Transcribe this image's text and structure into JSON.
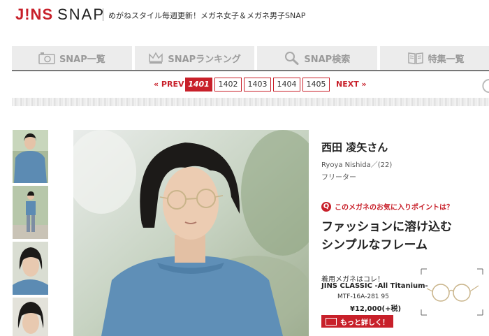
{
  "header": {
    "logo_brand": "J!NS",
    "logo_product": "SNAP",
    "tagline": "めがねスタイル毎週更新！メガネ女子＆メガネ男子SNAP"
  },
  "nav": {
    "items": [
      {
        "label": "SNAP一覧",
        "icon": "camera-icon"
      },
      {
        "label": "SNAPランキング",
        "icon": "crown-icon"
      },
      {
        "label": "SNAP検索",
        "icon": "magnifier-icon"
      },
      {
        "label": "特集一覧",
        "icon": "book-icon"
      }
    ]
  },
  "pager": {
    "prev": "« PREV",
    "next": "NEXT »",
    "pages": [
      "1401",
      "1402",
      "1403",
      "1404",
      "1405"
    ],
    "current": "1401"
  },
  "profile": {
    "name": "西田 凌矢さん",
    "romaji": "Ryoya Nishida／(22)",
    "occupation": "フリーター"
  },
  "favorite": {
    "question": "このメガネのお気に入りポイントは？",
    "catch_line1": "ファッションに溶け込む",
    "catch_line2": "シンプルなフレーム"
  },
  "product": {
    "wearing_label": "着用メガネはコレ！",
    "name": "JINS CLASSIC -All Titanium-",
    "code": "MTF-16A-281 95",
    "price": "¥12,000(+税)",
    "detail_button": "もっと詳しく！"
  },
  "colors": {
    "accent": "#c8202a",
    "nav_bg": "#ececec",
    "nav_text": "#9a9a9a"
  }
}
